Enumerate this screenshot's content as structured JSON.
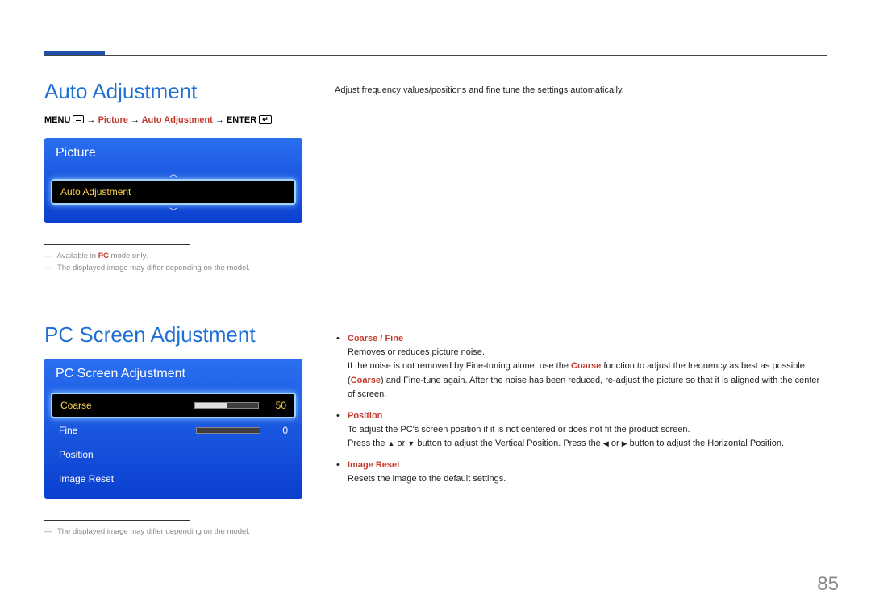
{
  "colors": {
    "accent_blue": "#1e6fd6",
    "accent_red": "#c33b2c",
    "osd_blue_top": "#2a6ff0",
    "osd_blue_bottom": "#0a3fcf",
    "highlight_yellow": "#ffd24a"
  },
  "page_number": "85",
  "section1": {
    "title": "Auto Adjustment",
    "path": {
      "menu": "MENU",
      "arrow": "→",
      "picture": "Picture",
      "auto_adjustment": "Auto Adjustment",
      "enter": "ENTER"
    },
    "osd": {
      "title": "Picture",
      "item": "Auto Adjustment"
    },
    "notes": {
      "n1_pre": "Available in ",
      "n1_accent": "PC",
      "n1_post": " mode only.",
      "n2": "The displayed image may differ depending on the model."
    },
    "right_text": "Adjust frequency values/positions and fine tune the settings automatically."
  },
  "section2": {
    "title": "PC Screen Adjustment",
    "osd": {
      "title": "PC Screen Adjustment",
      "rows": {
        "coarse": {
          "label": "Coarse",
          "value": "50",
          "fill_pct": 50
        },
        "fine": {
          "label": "Fine",
          "value": "0",
          "fill_pct": 0
        },
        "position": {
          "label": "Position"
        },
        "image_reset": {
          "label": "Image Reset"
        }
      }
    },
    "notes": {
      "n1": "The displayed image may differ depending on the model."
    },
    "right_list": {
      "b1_head": "Coarse / Fine",
      "b1_l1": "Removes or reduces picture noise.",
      "b1_l2_pre": "If the noise is not removed by Fine-tuning alone, use the ",
      "b1_l2_accent": "Coarse",
      "b1_l2_mid": " function to adjust the frequency as best as possible (",
      "b1_l2_accent2": "Coarse",
      "b1_l2_post": ") and Fine-tune again. After the noise has been reduced, re-adjust the picture so that it is aligned with the center of screen.",
      "b2_head": "Position",
      "b2_l1": "To adjust the PC's screen position if it is not centered or does not fit the product screen.",
      "b2_l2_pre": "Press the ",
      "b2_l2_mid1": " or ",
      "b2_l2_mid2": " button to adjust the Vertical Position. Press the ",
      "b2_l2_mid3": " or ",
      "b2_l2_post": " button to adjust the Horizontal Position.",
      "b3_head": "Image Reset",
      "b3_l1": "Resets the image to the default settings."
    }
  }
}
